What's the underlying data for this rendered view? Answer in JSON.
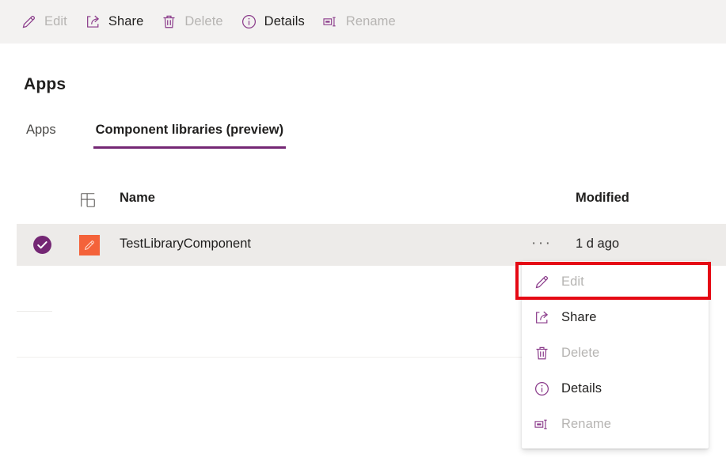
{
  "commandbar": {
    "items": [
      {
        "label": "Edit",
        "icon": "pencil-icon",
        "enabled": false
      },
      {
        "label": "Share",
        "icon": "share-icon",
        "enabled": true
      },
      {
        "label": "Delete",
        "icon": "trash-icon",
        "enabled": false
      },
      {
        "label": "Details",
        "icon": "info-icon",
        "enabled": true
      },
      {
        "label": "Rename",
        "icon": "rename-icon",
        "enabled": false
      }
    ]
  },
  "page": {
    "title": "Apps",
    "tabs": [
      {
        "label": "Apps",
        "selected": false
      },
      {
        "label": "Component libraries (preview)",
        "selected": true
      }
    ]
  },
  "list": {
    "columns": {
      "icon": "component-grid-icon",
      "name": "Name",
      "modified": "Modified"
    },
    "rows": [
      {
        "selected": true,
        "check_icon": "check-circle-icon",
        "app_icon": "pencil-app-icon",
        "name": "TestLibraryComponent",
        "overflow": "···",
        "modified": "1 d ago"
      }
    ]
  },
  "context_menu": {
    "items": [
      {
        "label": "Edit",
        "icon": "pencil-icon",
        "enabled": false,
        "highlighted": true
      },
      {
        "label": "Share",
        "icon": "share-icon",
        "enabled": true,
        "highlighted": false
      },
      {
        "label": "Delete",
        "icon": "trash-icon",
        "enabled": false,
        "highlighted": false
      },
      {
        "label": "Details",
        "icon": "info-icon",
        "enabled": true,
        "highlighted": false
      },
      {
        "label": "Rename",
        "icon": "rename-icon",
        "enabled": false,
        "highlighted": false
      }
    ]
  },
  "colors": {
    "accent_purple": "#742774",
    "icon_purple": "#8a3a8a",
    "app_tile_orange": "#f4623a",
    "annotation_red": "#e50914",
    "commandbar_bg": "#f3f2f1",
    "row_selected_bg": "#edebe9",
    "disabled_text": "#b6b4b2"
  }
}
